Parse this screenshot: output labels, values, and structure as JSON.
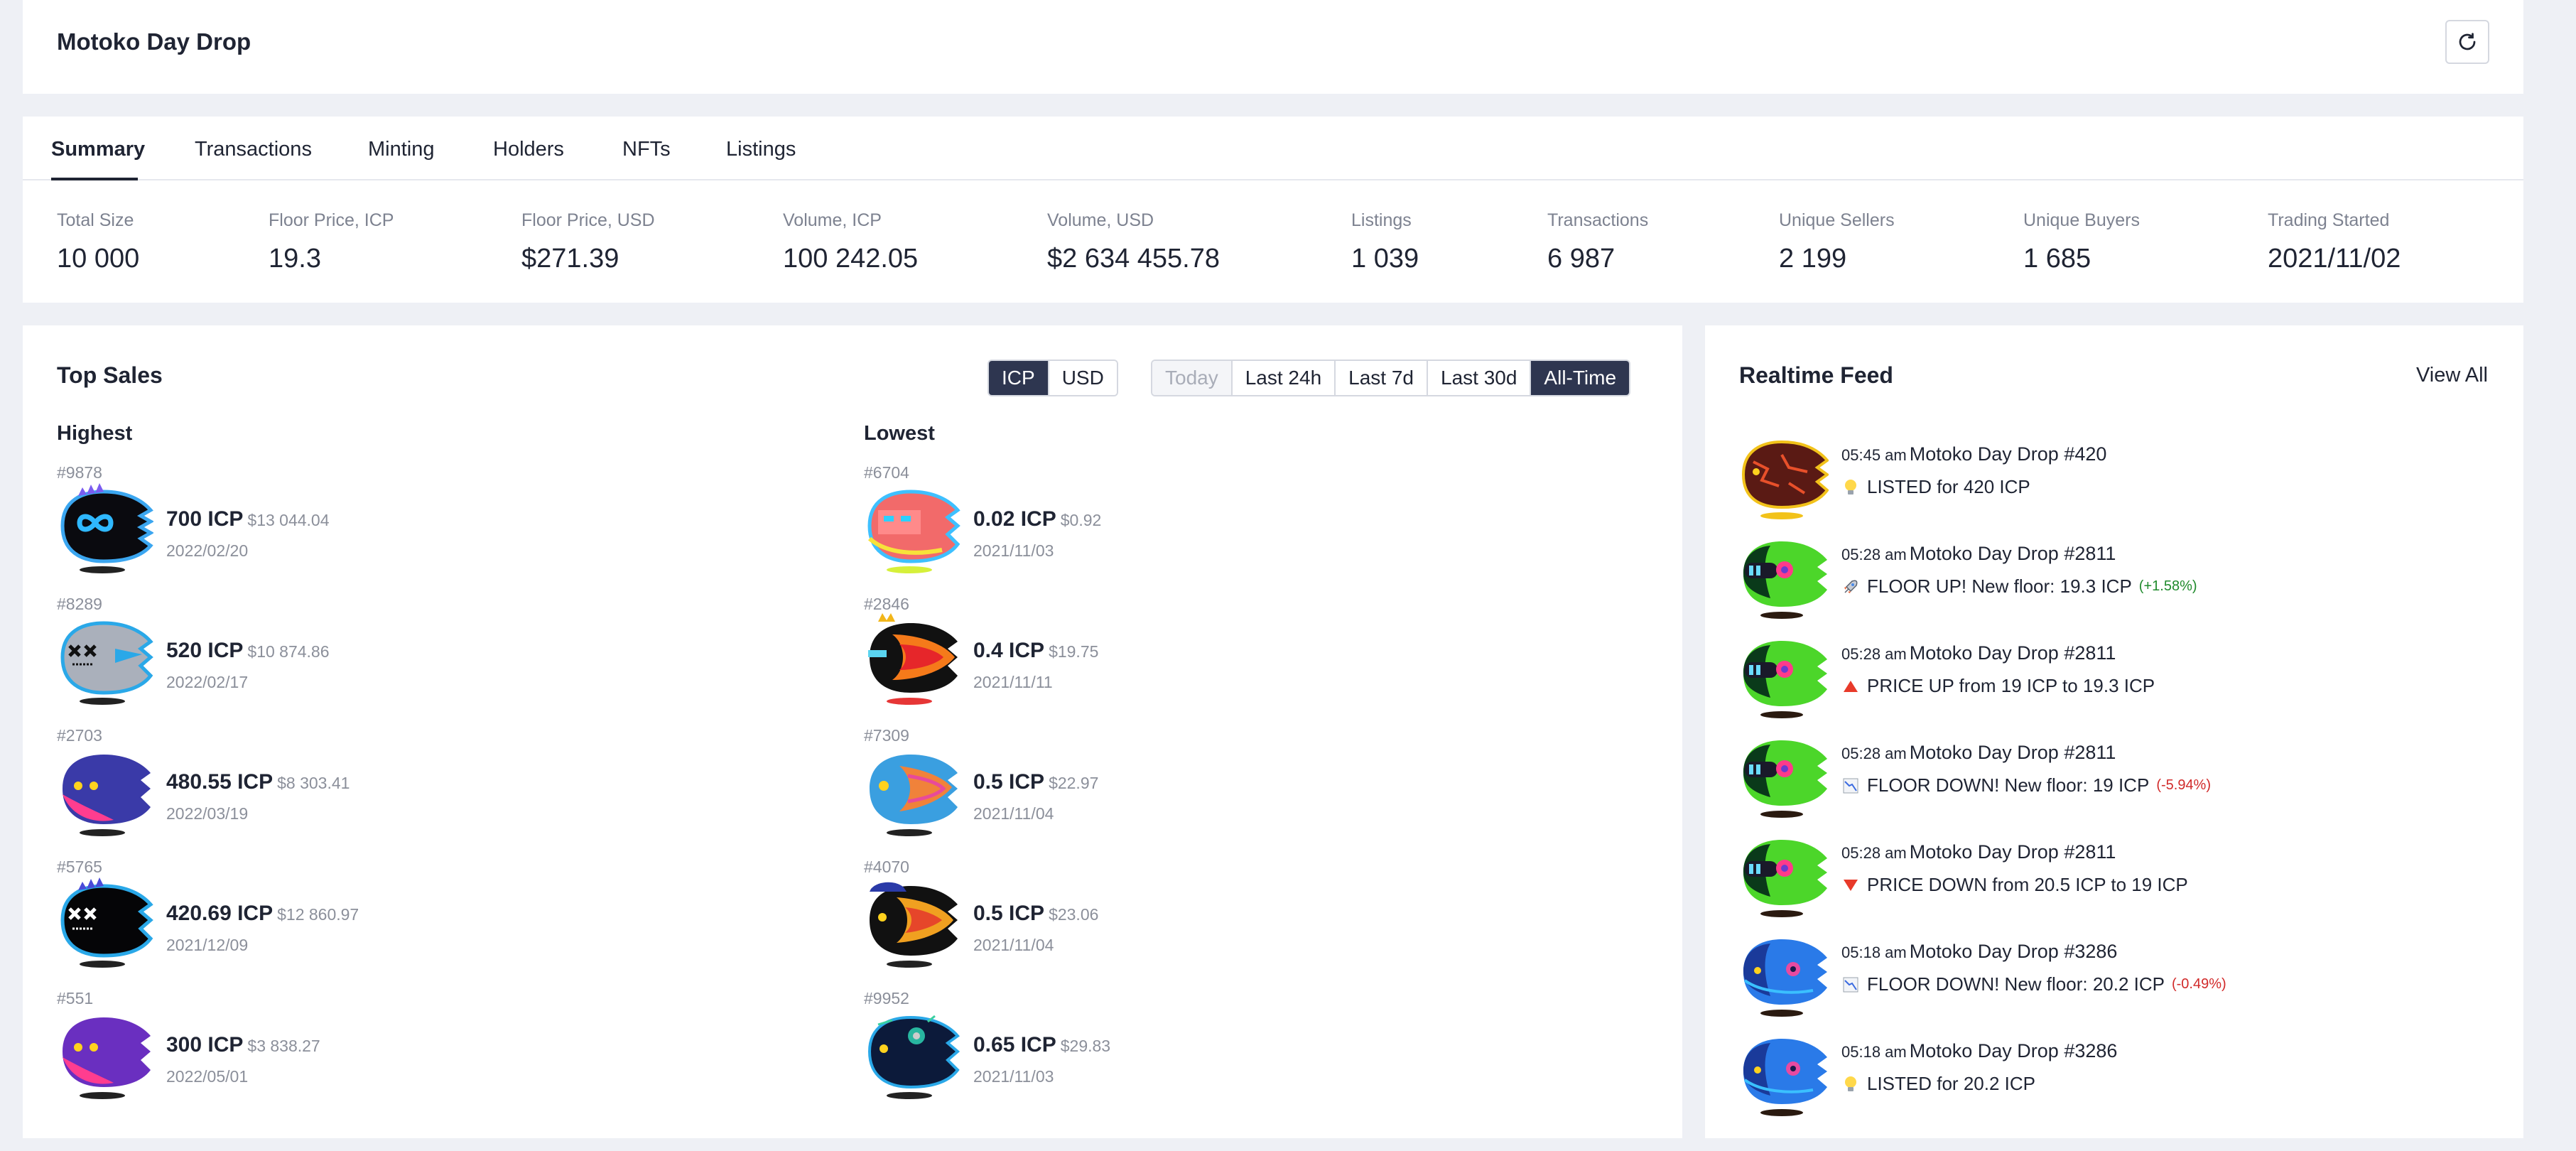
{
  "header": {
    "title": "Motoko Day Drop"
  },
  "tabs": [
    "Summary",
    "Transactions",
    "Minting",
    "Holders",
    "NFTs",
    "Listings"
  ],
  "stats": [
    {
      "label": "Total Size",
      "value": "10 000"
    },
    {
      "label": "Floor Price, ICP",
      "value": "19.3"
    },
    {
      "label": "Floor Price, USD",
      "value": "$271.39"
    },
    {
      "label": "Volume, ICP",
      "value": "100 242.05"
    },
    {
      "label": "Volume, USD",
      "value": "$2 634 455.78"
    },
    {
      "label": "Listings",
      "value": "1 039"
    },
    {
      "label": "Transactions",
      "value": "6 987"
    },
    {
      "label": "Unique Sellers",
      "value": "2 199"
    },
    {
      "label": "Unique Buyers",
      "value": "1 685"
    },
    {
      "label": "Trading Started",
      "value": "2021/11/02"
    }
  ],
  "top_sales": {
    "title": "Top Sales",
    "currency_options": [
      "ICP",
      "USD"
    ],
    "currency_selected": "ICP",
    "period_options": [
      "Today",
      "Last 24h",
      "Last 7d",
      "Last 30d",
      "All-Time"
    ],
    "period_selected": "All-Time",
    "period_disabled": "Today",
    "highest_label": "Highest",
    "lowest_label": "Lowest",
    "highest": [
      {
        "rank": "#9878",
        "price": "700 ICP",
        "usd": "$13 044.04",
        "date": "2022/02/20"
      },
      {
        "rank": "#8289",
        "price": "520 ICP",
        "usd": "$10 874.86",
        "date": "2022/02/17"
      },
      {
        "rank": "#2703",
        "price": "480.55 ICP",
        "usd": "$8 303.41",
        "date": "2022/03/19"
      },
      {
        "rank": "#5765",
        "price": "420.69 ICP",
        "usd": "$12 860.97",
        "date": "2021/12/09"
      },
      {
        "rank": "#551",
        "price": "300 ICP",
        "usd": "$3 838.27",
        "date": "2022/05/01"
      }
    ],
    "lowest": [
      {
        "rank": "#6704",
        "price": "0.02 ICP",
        "usd": "$0.92",
        "date": "2021/11/03"
      },
      {
        "rank": "#2846",
        "price": "0.4 ICP",
        "usd": "$19.75",
        "date": "2021/11/11"
      },
      {
        "rank": "#7309",
        "price": "0.5 ICP",
        "usd": "$22.97",
        "date": "2021/11/04"
      },
      {
        "rank": "#4070",
        "price": "0.5 ICP",
        "usd": "$23.06",
        "date": "2021/11/04"
      },
      {
        "rank": "#9952",
        "price": "0.65 ICP",
        "usd": "$29.83",
        "date": "2021/11/03"
      }
    ]
  },
  "feed": {
    "title": "Realtime Feed",
    "view_all": "View All",
    "items": [
      {
        "time": "05:45 am",
        "nft": "Motoko Day Drop #420",
        "icon": "lightbulb-icon",
        "text": "LISTED for 420 ICP",
        "pct": ""
      },
      {
        "time": "05:28 am",
        "nft": "Motoko Day Drop #2811",
        "icon": "rocket-icon",
        "text": "FLOOR UP! New floor: 19.3 ICP",
        "pct": "(+1.58%)"
      },
      {
        "time": "05:28 am",
        "nft": "Motoko Day Drop #2811",
        "icon": "triangle-up-icon",
        "text": "PRICE UP from 19 ICP to 19.3 ICP",
        "pct": ""
      },
      {
        "time": "05:28 am",
        "nft": "Motoko Day Drop #2811",
        "icon": "chart-down-icon",
        "text": "FLOOR DOWN! New floor: 19 ICP",
        "pct": "(-5.94%)"
      },
      {
        "time": "05:28 am",
        "nft": "Motoko Day Drop #2811",
        "icon": "triangle-down-icon",
        "text": "PRICE DOWN from 20.5 ICP to 19 ICP",
        "pct": ""
      },
      {
        "time": "05:18 am",
        "nft": "Motoko Day Drop #3286",
        "icon": "chart-down-icon",
        "text": "FLOOR DOWN! New floor: 20.2 ICP",
        "pct": "(-0.49%)"
      },
      {
        "time": "05:18 am",
        "nft": "Motoko Day Drop #3286",
        "icon": "lightbulb-icon",
        "text": "LISTED for 20.2 ICP",
        "pct": ""
      }
    ]
  },
  "colors": {
    "accent": "#2e3650",
    "pct_up": "#1f8a2c",
    "pct_down": "#d12a2a",
    "background": "#eef0f5"
  }
}
